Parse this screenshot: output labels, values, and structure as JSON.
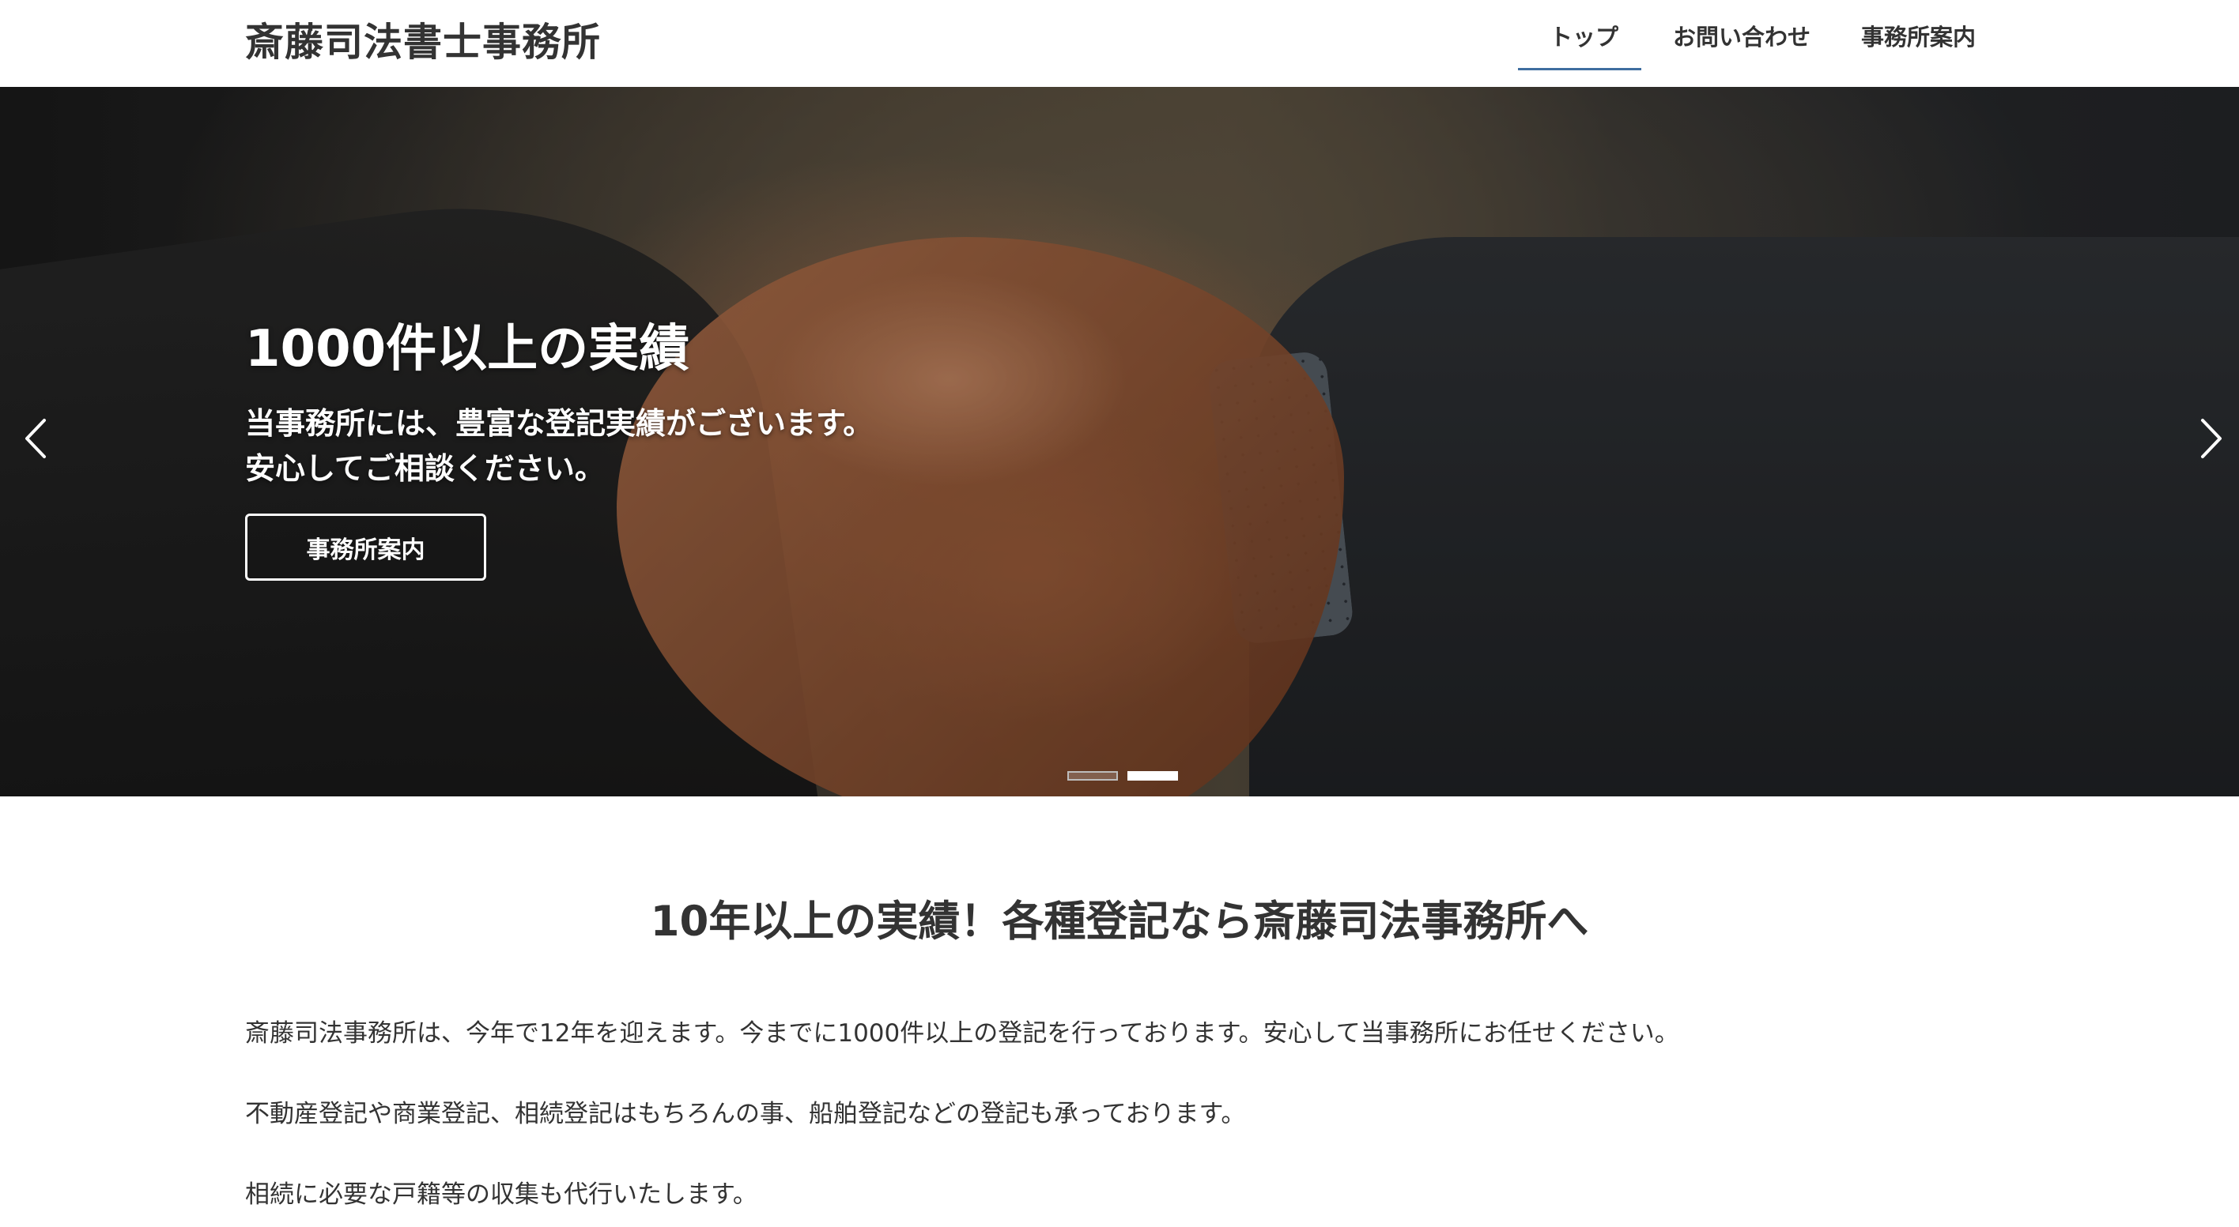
{
  "header": {
    "site_title": "斎藤司法書士事務所",
    "nav": [
      {
        "label": "トップ",
        "active": true
      },
      {
        "label": "お問い合わせ",
        "active": false
      },
      {
        "label": "事務所案内",
        "active": false
      }
    ],
    "accent_color": "#3f6ea0"
  },
  "hero": {
    "heading": "1000件以上の実績",
    "text_line1": "当事務所には、豊富な登記実績がございます。",
    "text_line2": "安心してご相談ください。",
    "button_label": "事務所案内",
    "prev_icon": "chevron-left-icon",
    "next_icon": "chevron-right-icon",
    "slides_total": 2,
    "active_slide": 2
  },
  "main": {
    "heading": "10年以上の実績！各種登記なら斎藤司法事務所へ",
    "paragraphs": [
      "斎藤司法事務所は、今年で12年を迎えます。今までに1000件以上の登記を行っております。安心して当事務所にお任せください。",
      "不動産登記や商業登記、相続登記はもちろんの事、船舶登記などの登記も承っております。",
      "相続に必要な戸籍等の収集も代行いたします。"
    ]
  }
}
